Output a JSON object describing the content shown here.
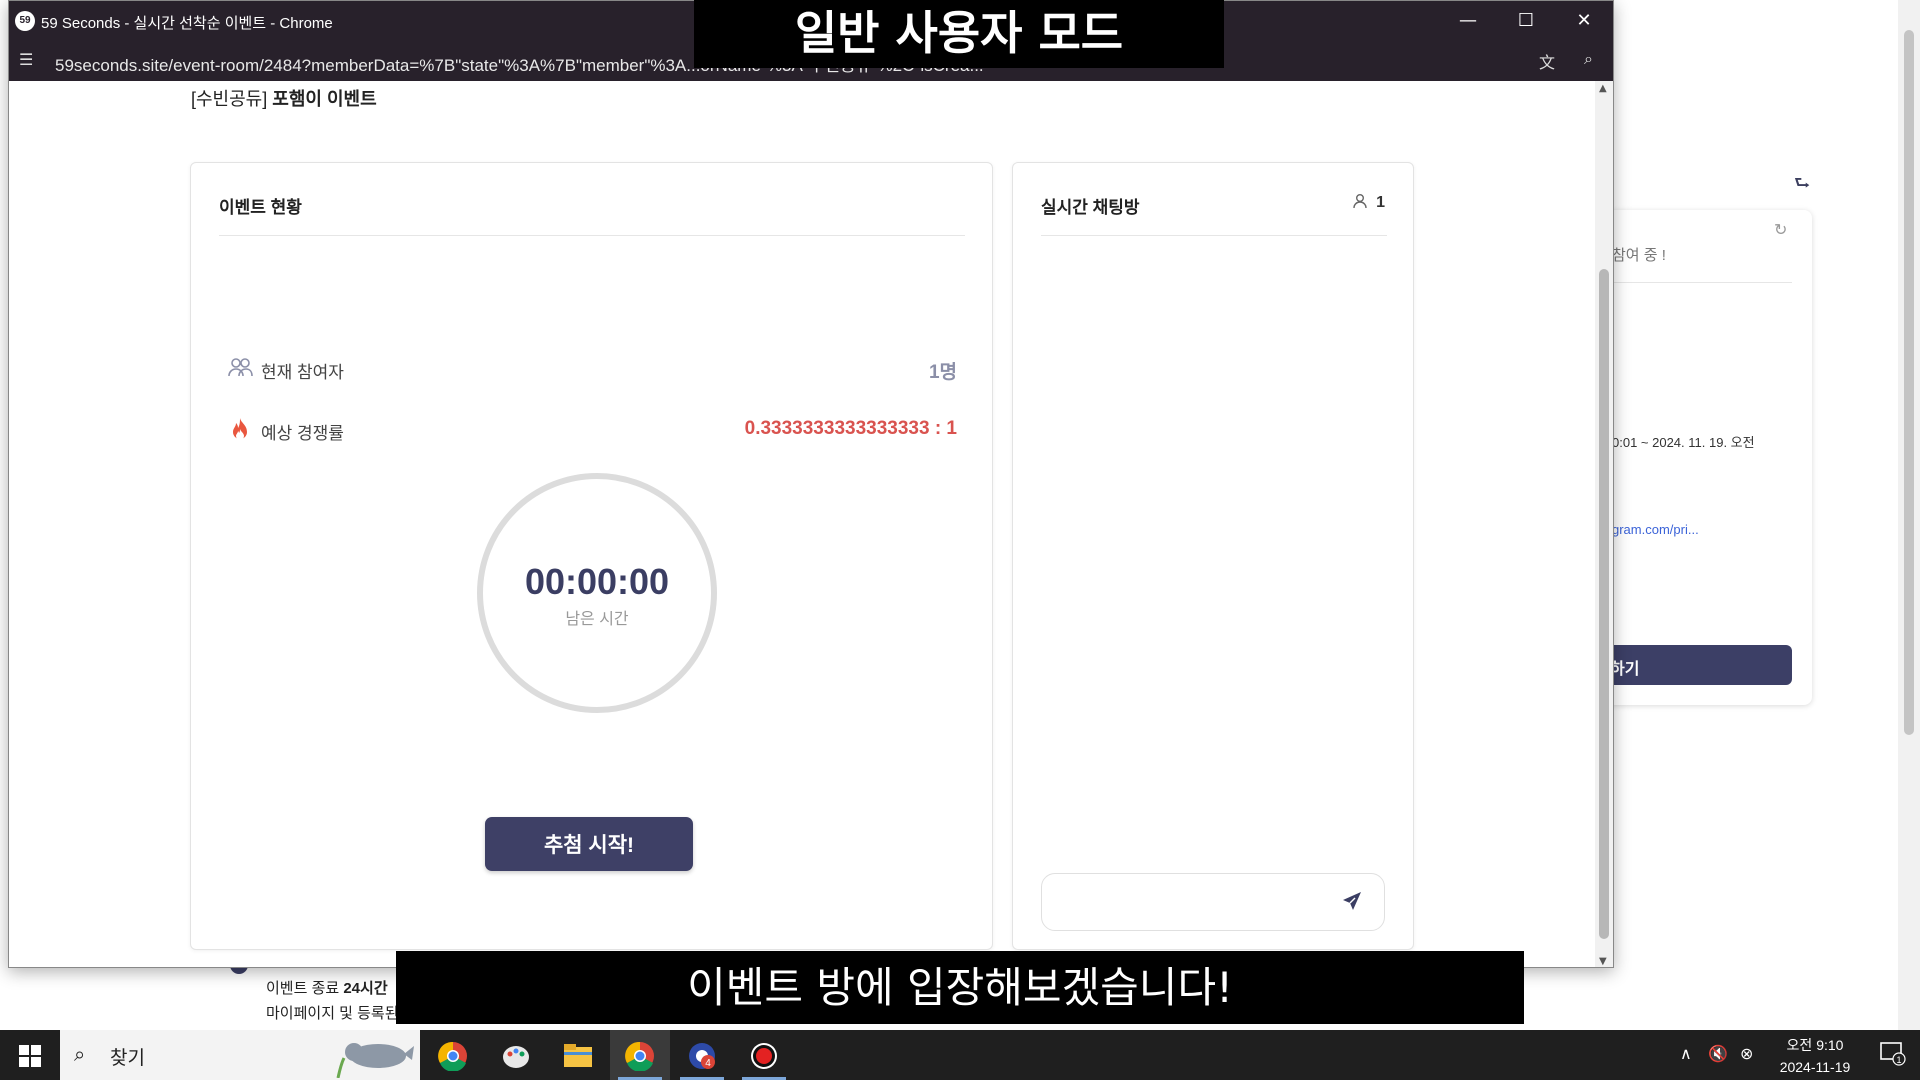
{
  "window": {
    "title": "59 Seconds - 실시간 선착순 이벤트 - Chrome",
    "favicon": "59",
    "url": "59seconds.site/event-room/2484?memberData=%7B\"state\"%3A%7B\"member\"%3A...orName\"%3A\"수빈공듀\"%2C\"isCrea..."
  },
  "event": {
    "host": "[수빈공듀]",
    "name": "포햄이 이벤트"
  },
  "status_panel": {
    "heading": "이벤트 현황",
    "participants_label": "현재 참여자",
    "participants_value": "1명",
    "competition_label": "예상 경쟁률",
    "competition_value": "0.3333333333333333 : 1",
    "timer_value": "00:00:00",
    "timer_label": "남은 시간",
    "draw_button": "추첨 시작!"
  },
  "chat_panel": {
    "heading": "실시간 채팅방",
    "user_count": "1",
    "input_placeholder": ""
  },
  "background_page": {
    "joining_text": "참여 중 !",
    "period_text": "0:01 ~ 2024. 11. 19. 오전",
    "link_text": "gram.com/pri...",
    "apply_button": "하기",
    "note_line1_prefix": "이벤트 종료",
    "note_line1_bold": "24시간",
    "note_line2": "마이페이지 및 등록된"
  },
  "overlays": {
    "mode_banner": "일반 사용자 모드",
    "subtitle": "이벤트 방에 입장해보겠습니다!"
  },
  "taskbar": {
    "search_placeholder": "찾기",
    "time": "오전 9:10",
    "date": "2024-11-19",
    "chrome_badge": "4",
    "notification_count": "1"
  },
  "icons": {
    "participants": "people-icon",
    "competition": "fire-icon",
    "chat_user": "person-icon",
    "send": "send-icon"
  },
  "colors": {
    "primary": "#3e4066",
    "competition_value": "#d9534f",
    "participant_value": "#8b8fa8",
    "titlebar": "#28212b"
  }
}
